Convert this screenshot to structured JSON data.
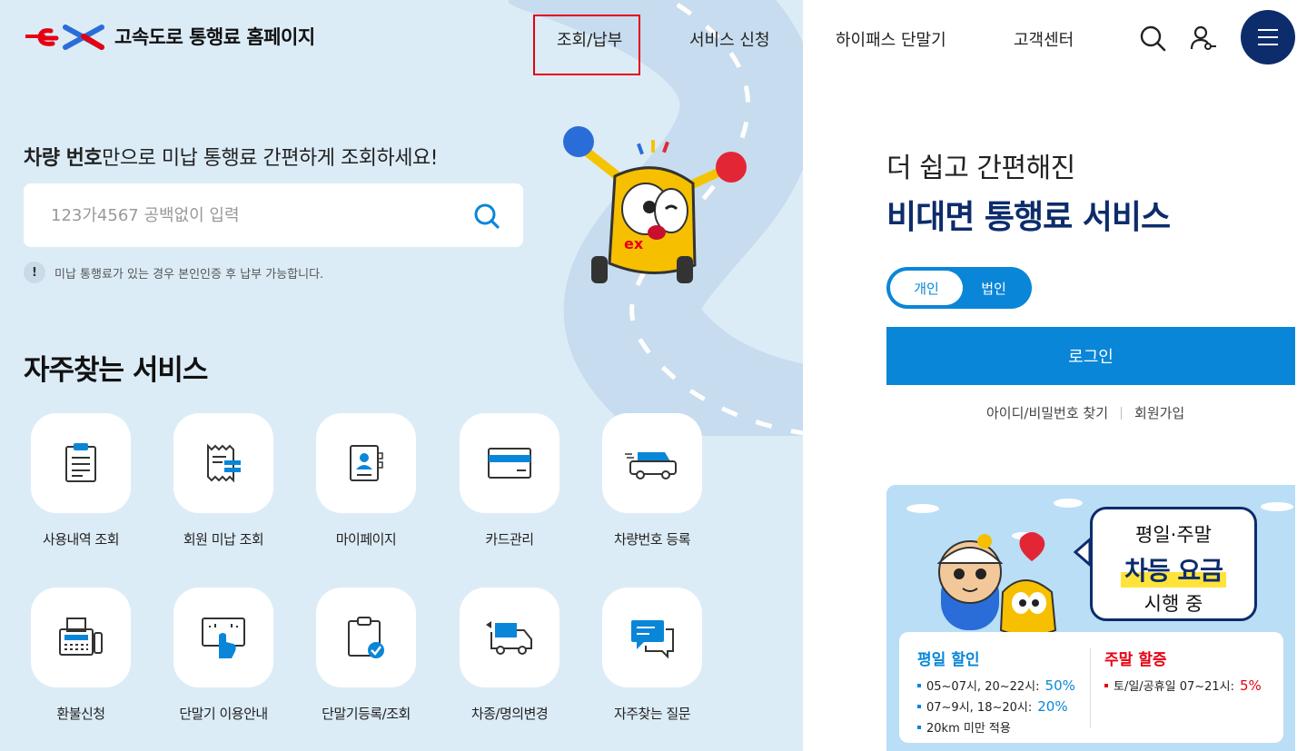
{
  "header": {
    "site_title": "고속도로 통행료 홈페이지",
    "nav": [
      {
        "label": "조회/납부"
      },
      {
        "label": "서비스 신청"
      },
      {
        "label": "하이패스 단말기"
      },
      {
        "label": "고객센터"
      }
    ]
  },
  "search": {
    "title_bold": "차량 번호",
    "title_rest": "만으로 미납 통행료 간편하게 조회하세요!",
    "placeholder": "123가4567 공백없이 입력",
    "notice_icon": "!",
    "notice": "미납 통행료가 있는 경우 본인인증 후 납부 가능합니다."
  },
  "services": {
    "title": "자주찾는 서비스",
    "items": [
      {
        "label": "사용내역 조회",
        "icon": "document-list-icon"
      },
      {
        "label": "회원 미납 조회",
        "icon": "receipt-icon"
      },
      {
        "label": "마이페이지",
        "icon": "profile-book-icon"
      },
      {
        "label": "카드관리",
        "icon": "card-icon"
      },
      {
        "label": "차량번호 등록",
        "icon": "car-icon"
      },
      {
        "label": "환불신청",
        "icon": "fax-icon"
      },
      {
        "label": "단말기 이용안내",
        "icon": "touch-screen-icon"
      },
      {
        "label": "단말기등록/조회",
        "icon": "clipboard-check-icon"
      },
      {
        "label": "차종/명의변경",
        "icon": "truck-exchange-icon"
      },
      {
        "label": "자주찾는 질문",
        "icon": "chat-icon"
      }
    ]
  },
  "login": {
    "subtitle": "더 쉽고 간편해진",
    "title": "비대면 통행료 서비스",
    "toggle_personal": "개인",
    "toggle_corporate": "법인",
    "login_button": "로그인",
    "find_account": "아이디/비밀번호 찾기",
    "signup": "회원가입"
  },
  "banner": {
    "line1": "평일·주말",
    "line2": "차등 요금",
    "line3": "시행 중",
    "weekday_title": "평일 할인",
    "weekday_lines": [
      {
        "text": "05~07시, 20~22시: ",
        "pct": "50%"
      },
      {
        "text": "07~9시, 18~20시: ",
        "pct": "20%"
      },
      {
        "text": "20km 미만 적용",
        "pct": ""
      }
    ],
    "weekend_title": "주말 할증",
    "weekend_lines": [
      {
        "text": "토/일/공휴일 07~21시: ",
        "pct": "5%"
      }
    ]
  },
  "colors": {
    "accent": "#0a86d8",
    "navy": "#0d2c6b",
    "brand_red": "#e60012",
    "panel_bg": "#dcecf7"
  }
}
